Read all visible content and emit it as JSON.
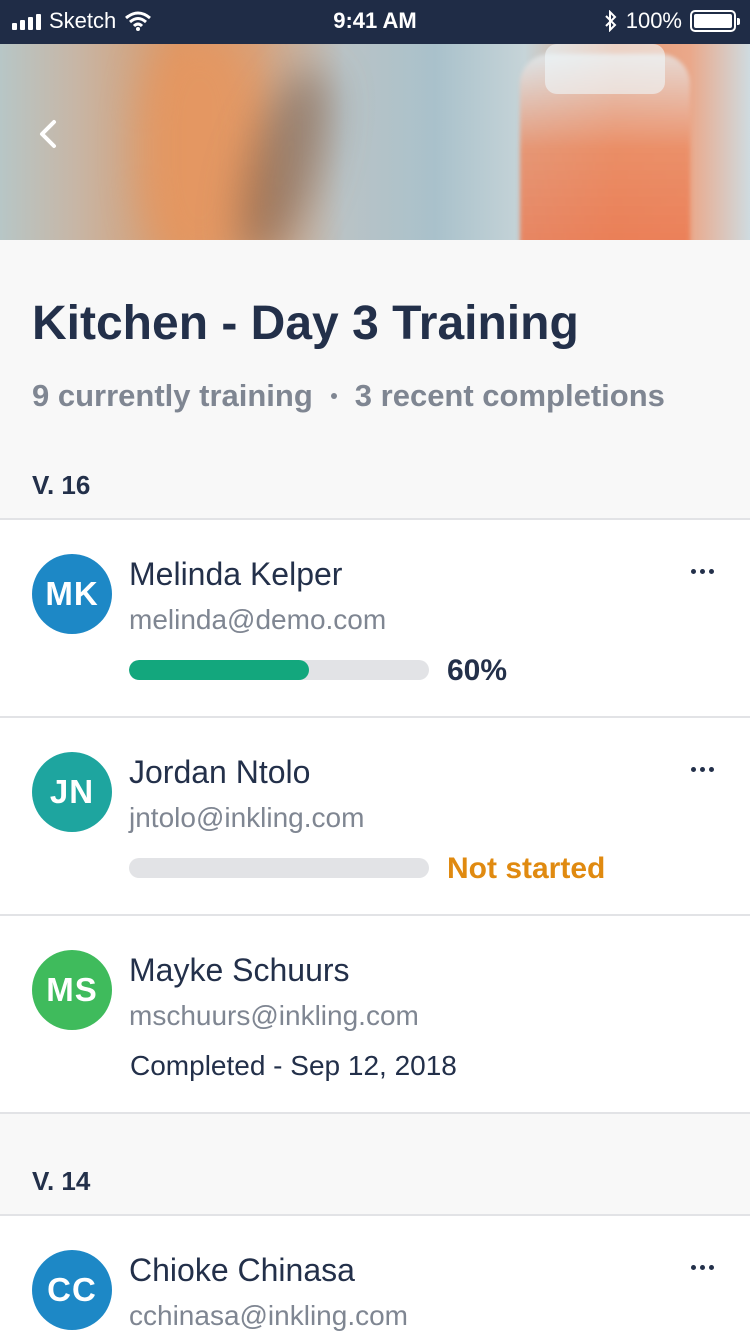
{
  "status_bar": {
    "carrier": "Sketch",
    "time": "9:41 AM",
    "battery": "100%"
  },
  "icons": {
    "back": "chevron-left-icon",
    "more": "ellipsis-icon",
    "bluetooth": "bluetooth-icon",
    "wifi": "wifi-icon"
  },
  "header": {
    "title": "Kitchen - Day 3 Training",
    "training_count": "9 currently training",
    "completions": "3 recent completions"
  },
  "sections": [
    {
      "version": "V. 16",
      "learners": [
        {
          "initials": "MK",
          "name": "Melinda Kelper",
          "email": "melinda@demo.com",
          "progress": 0.6,
          "status": "60%",
          "avatar_color": "#1d88c6",
          "status_color": "#23304a"
        },
        {
          "initials": "JN",
          "name": "Jordan Ntolo",
          "email": "jntolo@inkling.com",
          "progress": 0,
          "status": "Not started",
          "avatar_color": "#1ea59f",
          "status_color": "#e08a10"
        },
        {
          "initials": "MS",
          "name": "Mayke Schuurs",
          "email": "mschuurs@inkling.com",
          "status": "Completed - Sep 12, 2018",
          "avatar_color": "#3fbb5c"
        }
      ]
    },
    {
      "version": "V. 14",
      "learners": [
        {
          "initials": "CC",
          "name": "Chioke Chinasa",
          "email": "cchinasa@inkling.com",
          "avatar_color": "#1d88c6"
        }
      ]
    }
  ]
}
